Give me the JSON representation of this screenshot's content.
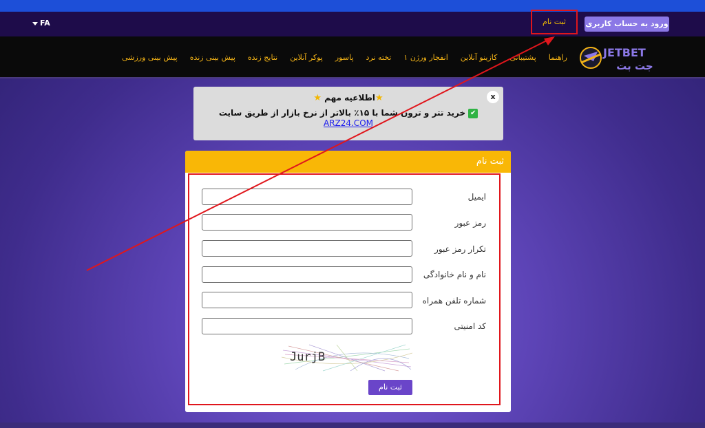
{
  "topbar": {
    "language": "FA",
    "login_button": "ورود به حساب کاربری",
    "register_link": "ثبت نام"
  },
  "brand": {
    "logo_text_latin": "JETBET",
    "logo_text_persian": "جت بت"
  },
  "nav": {
    "items": [
      "پیش بینی ورزشی",
      "پیش بینی زنده",
      "نتایج زنده",
      "پوکر آنلاین",
      "پاسور",
      "تخته نرد",
      "انفجار ورژن ۱",
      "کازینو آنلاین",
      "پشتیبانی",
      "راهنما"
    ]
  },
  "notice": {
    "close": "x",
    "title": "اطلاعیه مهم",
    "body_text": "خرید تتر و ترون شما با ۱۵٪ بالاتر از نرخ بازار از طریق سایت",
    "link_text": "ARZ24.COM"
  },
  "form": {
    "header": "ثبت نام",
    "fields": [
      {
        "label": "ایمیل",
        "value": ""
      },
      {
        "label": "رمز عبور",
        "value": ""
      },
      {
        "label": "تکرار رمز عبور",
        "value": ""
      },
      {
        "label": "نام و نام خانوادگی",
        "value": ""
      },
      {
        "label": "شماره تلفن همراه",
        "value": ""
      },
      {
        "label": "کد امنیتی",
        "value": ""
      }
    ],
    "captcha_text": "JurjB",
    "submit": "ثبت نام"
  },
  "colors": {
    "accent": "#f9b706",
    "highlight": "#e0161c",
    "primary": "#6a45c9"
  }
}
